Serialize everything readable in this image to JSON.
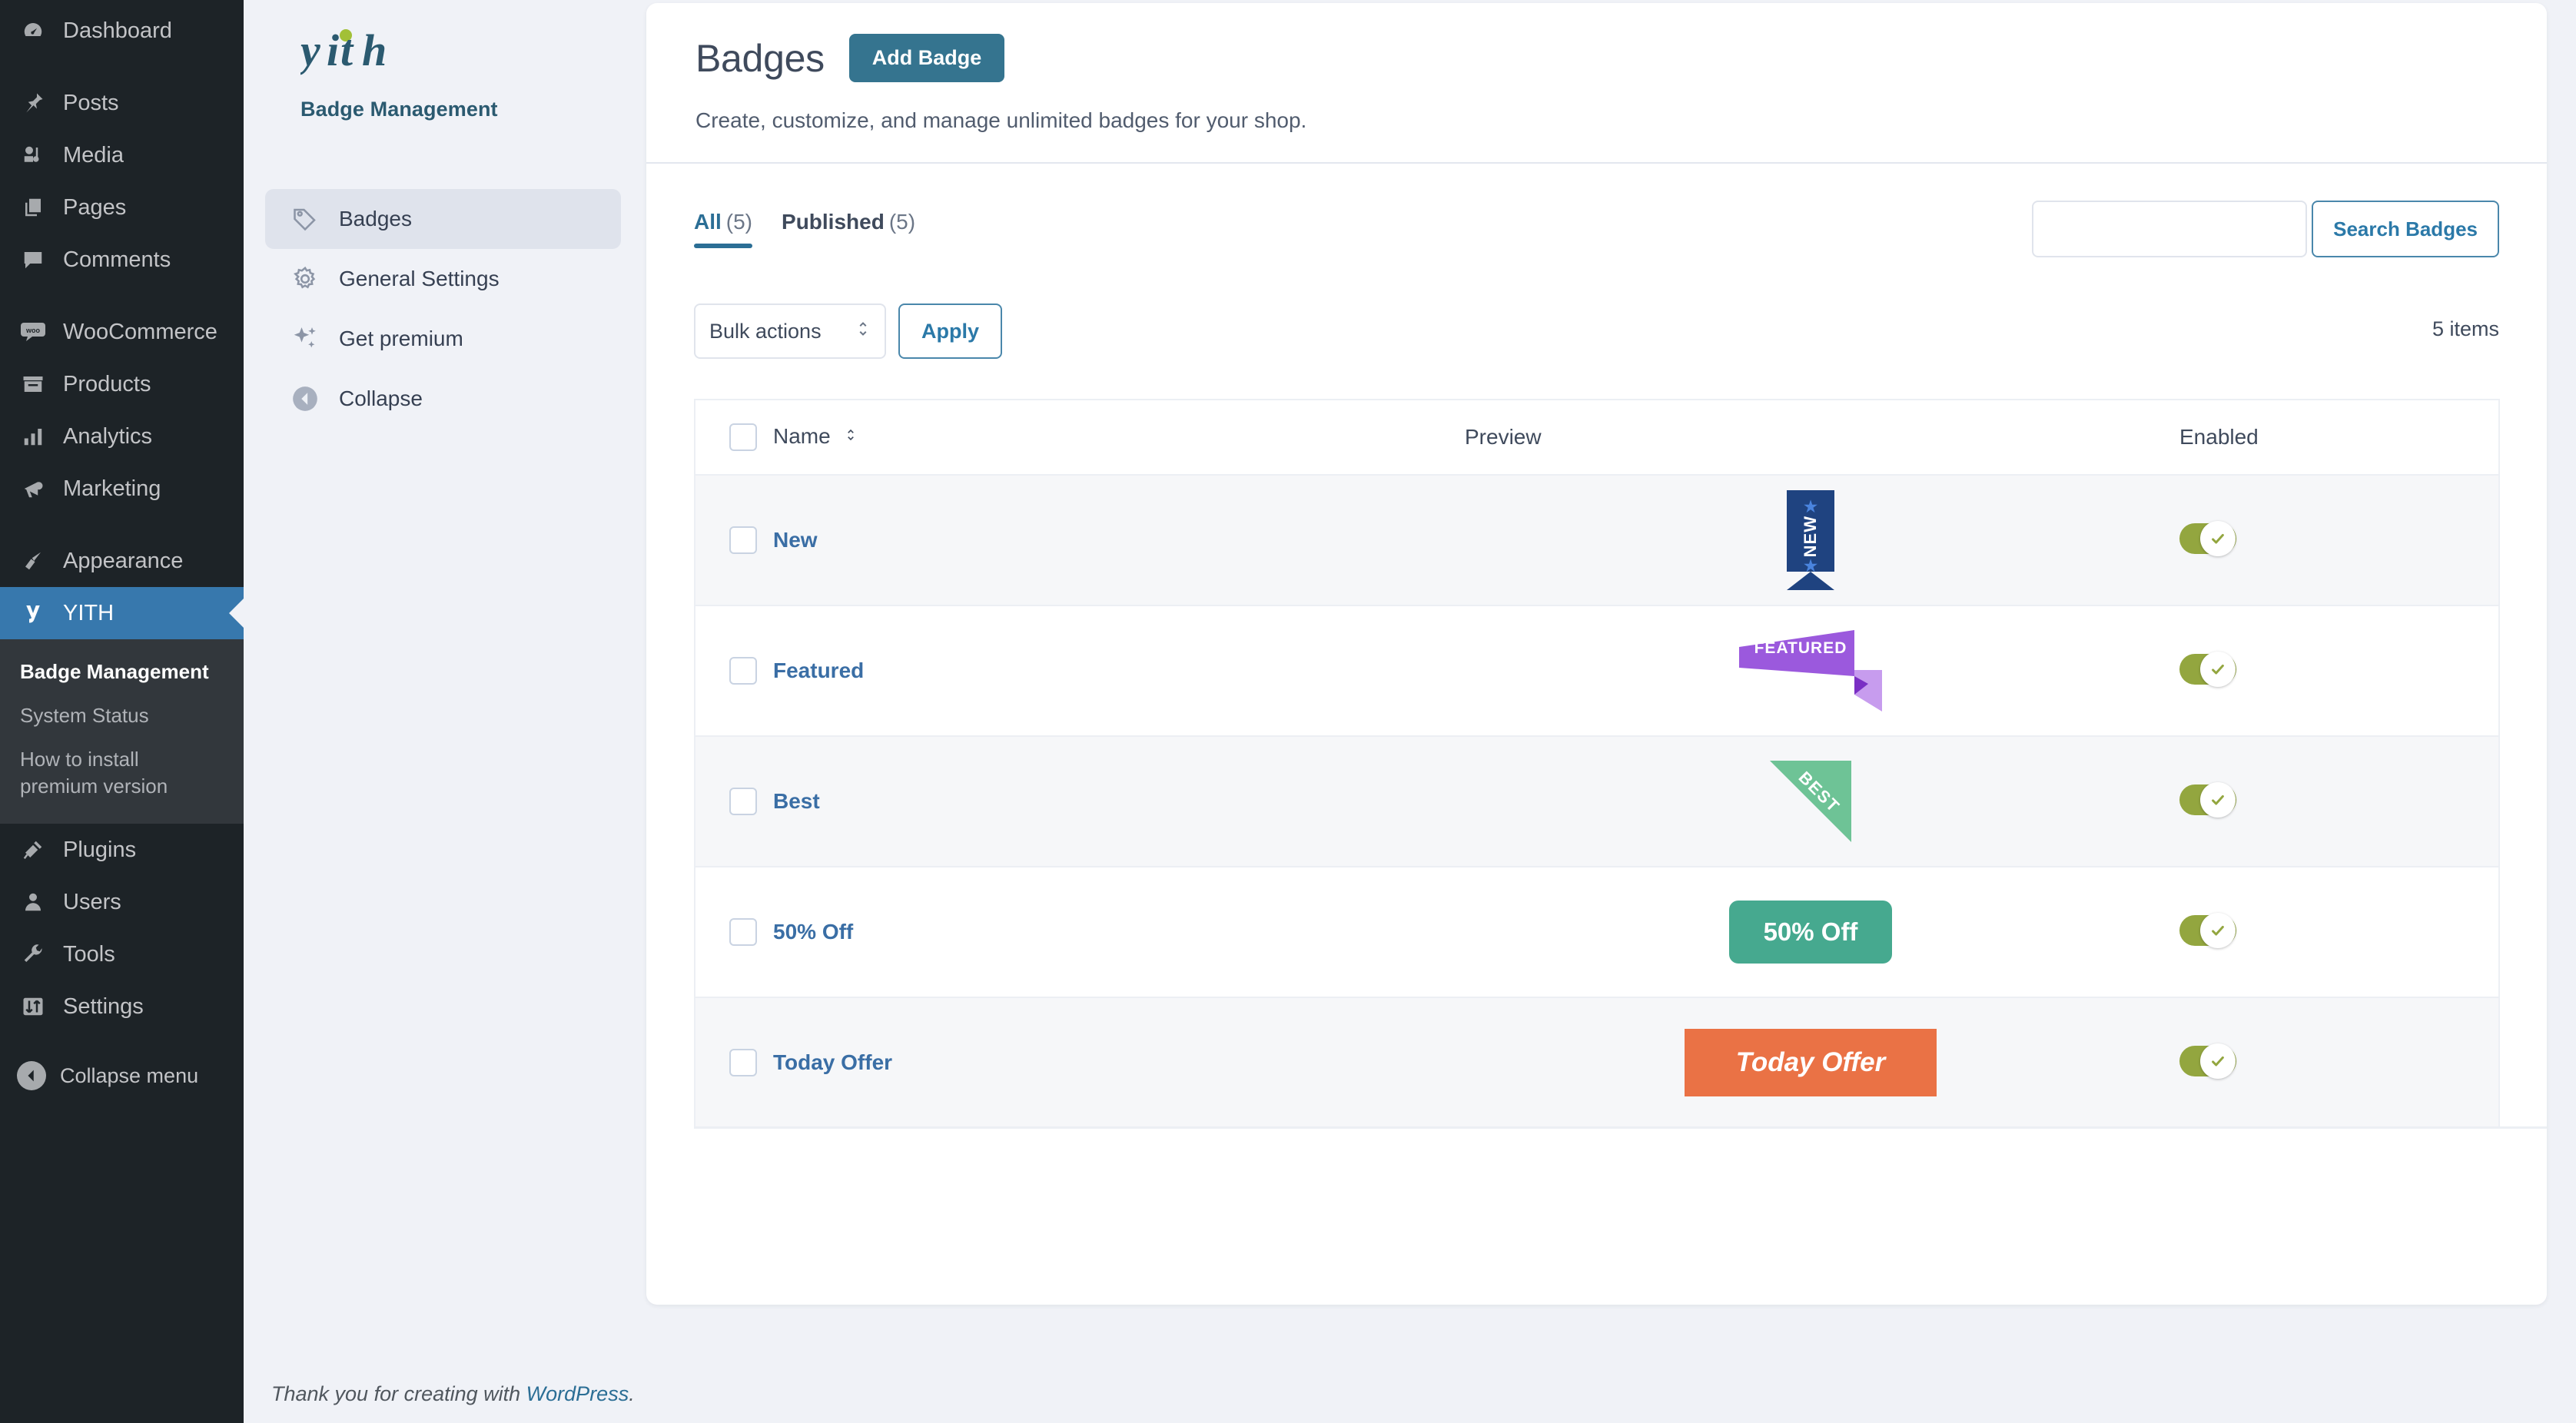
{
  "wp_sidebar": {
    "items": [
      {
        "label": "Dashboard",
        "icon": "dashboard-icon"
      },
      {
        "label": "Posts",
        "icon": "pin-icon"
      },
      {
        "label": "Media",
        "icon": "media-icon"
      },
      {
        "label": "Pages",
        "icon": "pages-icon"
      },
      {
        "label": "Comments",
        "icon": "comment-icon"
      },
      {
        "label": "WooCommerce",
        "icon": "woo-icon"
      },
      {
        "label": "Products",
        "icon": "products-icon"
      },
      {
        "label": "Analytics",
        "icon": "bar-chart-icon"
      },
      {
        "label": "Marketing",
        "icon": "megaphone-icon"
      },
      {
        "label": "Appearance",
        "icon": "brush-icon"
      },
      {
        "label": "YITH",
        "icon": "yith-icon"
      },
      {
        "label": "Plugins",
        "icon": "plug-icon"
      },
      {
        "label": "Users",
        "icon": "user-icon"
      },
      {
        "label": "Tools",
        "icon": "wrench-icon"
      },
      {
        "label": "Settings",
        "icon": "sliders-icon"
      }
    ],
    "submenu": [
      {
        "label": "Badge Management"
      },
      {
        "label": "System Status"
      },
      {
        "label": "How to install premium version"
      }
    ],
    "collapse_label": "Collapse menu",
    "active_item": "YITH",
    "accent": "#3778ad"
  },
  "plugin_panel": {
    "logo_text": "yith",
    "subtitle": "Badge Management",
    "nav": [
      {
        "label": "Badges",
        "icon": "tag-icon",
        "selected": true
      },
      {
        "label": "General Settings",
        "icon": "gear-icon",
        "selected": false
      },
      {
        "label": "Get premium",
        "icon": "sparkles-icon",
        "selected": false
      },
      {
        "label": "Collapse",
        "icon": "arrow-left-circle-icon",
        "selected": false
      }
    ]
  },
  "header": {
    "title": "Badges",
    "add_button": "Add Badge",
    "description": "Create, customize, and manage unlimited badges for your shop."
  },
  "toolbar": {
    "tabs": [
      {
        "label": "All",
        "count": "(5)",
        "active": true
      },
      {
        "label": "Published",
        "count": "(5)",
        "active": false
      }
    ],
    "search_value": "",
    "search_placeholder": "",
    "search_button": "Search Badges",
    "bulk_actions_label": "Bulk actions",
    "apply_label": "Apply",
    "items_count": "5 items"
  },
  "table": {
    "columns": [
      "Name",
      "Preview",
      "Enabled"
    ],
    "rows": [
      {
        "name": "New",
        "preview_text": "NEW",
        "preview_style": "ribbon-vertical",
        "color": "#1f4380",
        "enabled": true
      },
      {
        "name": "Featured",
        "preview_text": "FEATURED",
        "preview_style": "banner-angled",
        "color": "#9b59dd",
        "enabled": true
      },
      {
        "name": "Best",
        "preview_text": "BEST",
        "preview_style": "corner-triangle",
        "color": "#6ec396",
        "enabled": true
      },
      {
        "name": "50% Off",
        "preview_text": "50% Off",
        "preview_style": "rounded-pill",
        "color": "#46a98f",
        "enabled": true
      },
      {
        "name": "Today Offer",
        "preview_text": "Today Offer",
        "preview_style": "rect-italic",
        "color": "#ea7245",
        "enabled": true
      }
    ]
  },
  "footer": {
    "prefix": "Thank you for creating with ",
    "link": "WordPress",
    "suffix": "."
  }
}
